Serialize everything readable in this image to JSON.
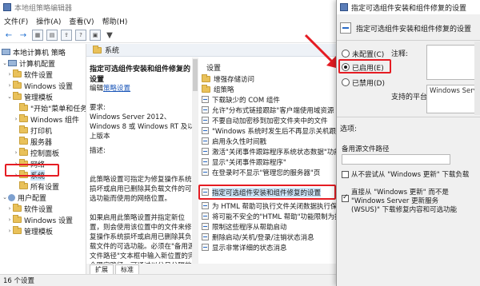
{
  "main_window": {
    "title": "本地组策略编辑器",
    "menu": [
      "文件(F)",
      "操作(A)",
      "查看(V)",
      "帮助(H)"
    ]
  },
  "tree": {
    "root": "本地计算机 策略",
    "computer_config": "计算机配置",
    "software_settings": "软件设置",
    "windows_settings": "Windows 设置",
    "admin_templates": "管理模板",
    "start_menu": "\"开始\"菜单和任务栏",
    "windows_components": "Windows 组件",
    "printers": "打印机",
    "server": "服务器",
    "control_panel": "控制面板",
    "network": "网络",
    "system": "系统",
    "all_settings": "所有设置",
    "user_config": "用户配置",
    "u_software_settings": "软件设置",
    "u_windows_settings": "Windows 设置",
    "u_admin_templates": "管理模板"
  },
  "pane_header": "系统",
  "description": {
    "title": "指定可选组件安装和组件修复的设置",
    "edit_prefix": "编辑",
    "edit_link": "策略设置",
    "requirements_label": "要求:",
    "requirements_text": "Windows Server 2012、Windows 8 或 Windows RT 及以上版本",
    "desc_label": "描述:",
    "desc_text": "此策略设置可指定为修复操作系统损坏或启用已删除其负载文件的可选功能而使用的网络位置。",
    "desc_text2": "如果启用此策略设置并指定新位置，则会使用该位置中的文件来修复操作系统损坏或启用已删除其负载文件的可选功能。必须在\"备用源文件路径\"文本框中输入新位置的完全限定路径。可通过以分号分隔的方"
  },
  "settings_list": {
    "header": "设置",
    "items": [
      {
        "label": "增强存储访问",
        "type": "folder"
      },
      {
        "label": "组策略",
        "type": "folder"
      },
      {
        "label": "下载缺少的 COM 组件",
        "type": "setting"
      },
      {
        "label": "允许\"分布式链接跟踪\"客户端使用域资源",
        "type": "setting"
      },
      {
        "label": "不要自动加密移到加密文件夹中的文件",
        "type": "setting"
      },
      {
        "label": "\"Windows 系统时发生后不再显示关机跟踪程序\"",
        "type": "setting"
      },
      {
        "label": "启用永久性时间戳",
        "type": "setting"
      },
      {
        "label": "激活\"关闭事件跟踪程序系统状态数据\"功能",
        "type": "setting"
      },
      {
        "label": "显示\"关闭事件跟踪程序\"",
        "type": "setting"
      },
      {
        "label": "在登录时不显示\"管理您的服务器\"页",
        "type": "setting"
      },
      {
        "label": "指定可选组件安装和组件修复的设置",
        "type": "setting",
        "selected": true
      },
      {
        "label": "为 HTML 帮助可执行文件关闭数据执行保护",
        "type": "setting"
      },
      {
        "label": "将可能不安全的\"HTML 帮助\"功能限制为指定文件夹",
        "type": "setting"
      },
      {
        "label": "限制这些程序从帮助启动",
        "type": "setting"
      },
      {
        "label": "删除启动/关机/登录/注销状态消息",
        "type": "setting"
      },
      {
        "label": "显示非常详细的状态消息",
        "type": "setting"
      }
    ]
  },
  "tabs": [
    "扩展",
    "标准"
  ],
  "statusbar": "16 个设置",
  "dialog": {
    "title": "指定可选组件安装和组件修复的设置",
    "header": "指定可选组件安装和组件修复的设置",
    "options": [
      "未配置(C)",
      "已启用(E)",
      "已禁用(D)"
    ],
    "selected_option": 1,
    "comment_label": "注释:",
    "supported_label": "支持的平台:",
    "supported_value": "Windows Server",
    "options_label": "选项:",
    "alt_source_label": "备用源文件路径",
    "alt_source_value": "",
    "cb1_text": "从不尝试从 \"Windows 更新\" 下载负载",
    "cb2_line1": "直接从 \"Windows 更新\" 而不是",
    "cb2_line2": "\"Windows Server 更新服务",
    "cb2_line3": "(WSUS)\" 下载修复内容和可选功能"
  },
  "colors": {
    "highlight_red": "#e51c23",
    "selection": "#cce4f7",
    "link": "#1a56b8"
  }
}
